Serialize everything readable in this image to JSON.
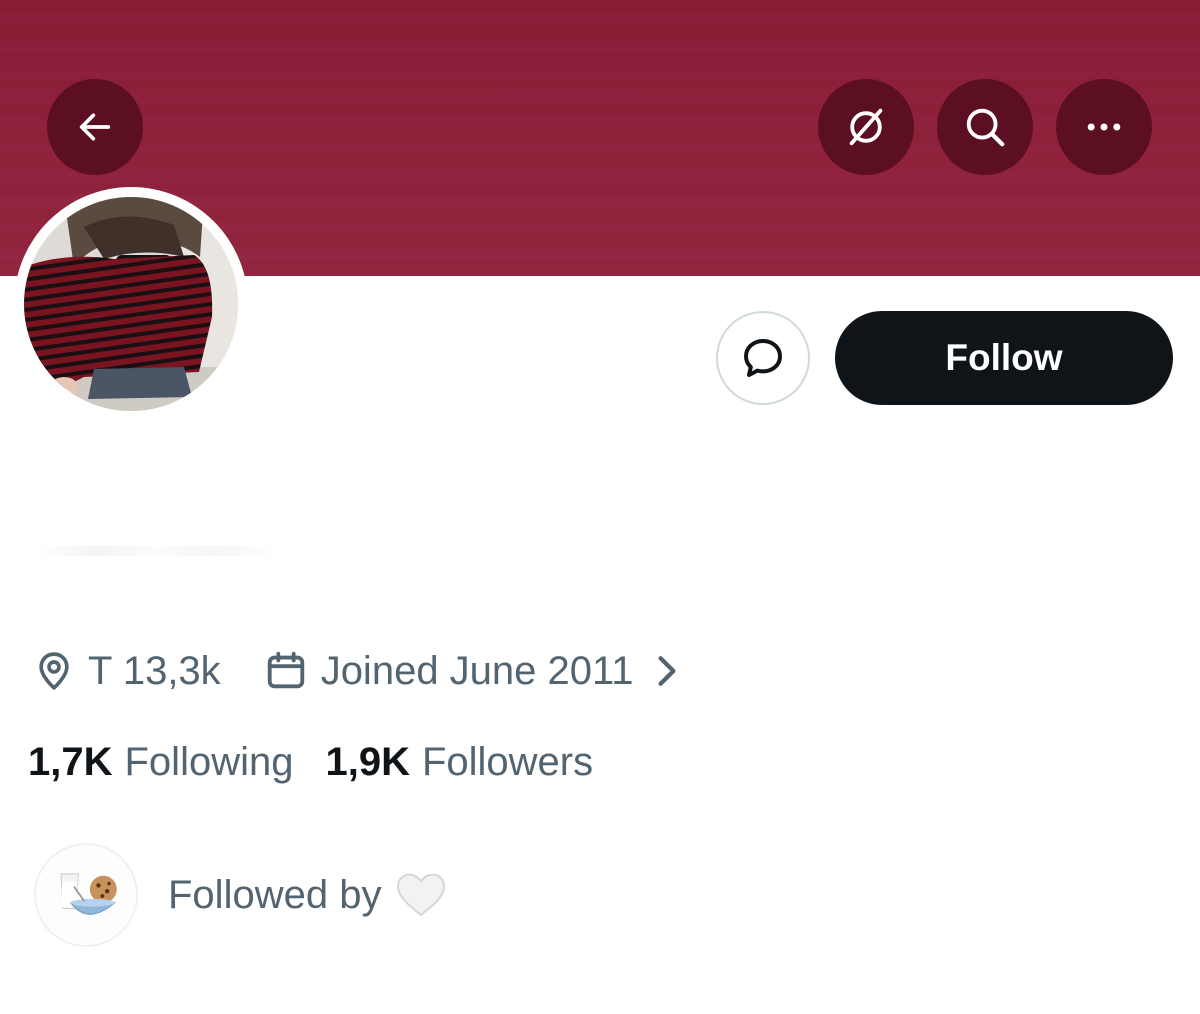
{
  "header": {
    "back_icon": "arrow-left-icon",
    "grok_icon": "grok-icon",
    "search_icon": "search-icon",
    "more_icon": "more-horizontal-icon",
    "banner_color": "#8e1e38",
    "button_bg": "#5c0f20"
  },
  "profile": {
    "avatar_description": "profile-photo",
    "message_icon": "message-bubble-icon",
    "follow_label": "Follow"
  },
  "meta": {
    "location_icon": "location-pin-icon",
    "location": "T 13,3k",
    "calendar_icon": "calendar-icon",
    "joined": "Joined June 2011",
    "chevron_icon": "chevron-right-icon"
  },
  "stats": {
    "following_count": "1,7K",
    "following_label": "Following",
    "followers_count": "1,9K",
    "followers_label": "Followers"
  },
  "followed_by": {
    "label": "Followed by",
    "emoji": "🤍"
  },
  "colors": {
    "text_primary": "#0f1419",
    "text_secondary": "#536471",
    "follow_button": "#0f1419",
    "border": "#cfd9de"
  }
}
